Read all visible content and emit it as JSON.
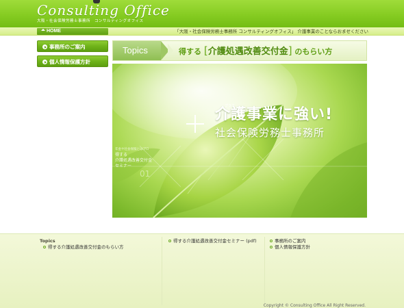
{
  "header": {
    "logo_main": "Consulting Office",
    "logo_sub": "大阪・社会保険労務士事務所　コンサルティングオフィス"
  },
  "navbar": {
    "home_label": "HOME",
    "tagline": "「大阪・社会保険労務士事務所 コンサルティングオフィス」 介護事業のことならおませください"
  },
  "sidebar": {
    "items": [
      {
        "label": "事務所のご案内",
        "icon": "arrow-circle-icon"
      },
      {
        "label": "個人情報保護方針",
        "icon": "arrow-circle-icon"
      }
    ]
  },
  "topics": {
    "tab_label": "Topics",
    "title_prefix": "得する",
    "bracket_open": "[",
    "title_main": "介護処遇改善交付金",
    "bracket_close": "]",
    "title_suffix": "のもらい方"
  },
  "hero": {
    "plus_label": "プラス",
    "headline": "介護事業に強い!",
    "subheadline": "社会保険労務士事務所",
    "overlay_line1": "年金や社会保険とはプロ",
    "overlay_line2": "得する",
    "overlay_line3": "介護処遇改善交付金",
    "overlay_line4": "セミナー",
    "overlay_num": "01"
  },
  "footer": {
    "col1": {
      "heading": "Topics",
      "links": [
        "得する介護処遇改善交付金のもらい方"
      ]
    },
    "col2": {
      "links": [
        "得する介護処遇改善交付金セミナー (pdf)"
      ]
    },
    "col3": {
      "links": [
        "事務所のご案内",
        "個人情報保護方針"
      ]
    },
    "copyright": "Copyright © Consulting Office All Right Reserved."
  },
  "colors": {
    "brand_green": "#7dc41c",
    "dark_green": "#5c9e10",
    "footer_bg": "#eef5cf"
  }
}
